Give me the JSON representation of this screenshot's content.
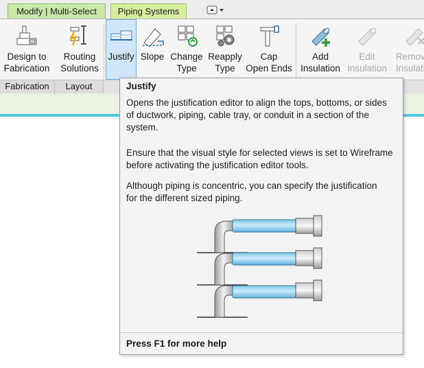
{
  "tabs": {
    "modify_label": "Modify | Multi-Select",
    "piping_label": "Piping Systems"
  },
  "ribbon": {
    "buttons": [
      {
        "line1": "Design to",
        "line2": "Fabrication"
      },
      {
        "line1": "Routing",
        "line2": "Solutions"
      },
      {
        "line1": "Justify",
        "line2": ""
      },
      {
        "line1": "Slope",
        "line2": ""
      },
      {
        "line1": "Change",
        "line2": "Type"
      },
      {
        "line1": "Reapply",
        "line2": "Type"
      },
      {
        "line1": "Cap",
        "line2": "Open Ends"
      },
      {
        "line1": "Add",
        "line2": "Insulation"
      },
      {
        "line1": "Edit",
        "line2": "Insulation"
      },
      {
        "line1": "Remov",
        "line2": "Insulati"
      }
    ],
    "panels": [
      "Fabrication",
      "Layout"
    ]
  },
  "tooltip": {
    "title": "Justify",
    "p1a": "Opens the justification editor to align the tops, bottoms, or sides",
    "p1b": "of ductwork, piping, cable tray, or conduit in a section of the",
    "p1c": "system.",
    "p2a": "Ensure that the visual style for selected views is set to Wireframe",
    "p2b": "before activating the justification editor tools.",
    "p3a": "Although piping is concentric, you can specify the justification",
    "p3b": "for the different sized piping.",
    "help": "Press F1 for more help"
  },
  "colors": {
    "modify_tab": "#c9e7a8",
    "piping_tab": "#d7ee9f",
    "active_button": "#cfe7f8",
    "accent_line": "#4ec8e0",
    "pipe_blue": "#a9dcf3"
  }
}
